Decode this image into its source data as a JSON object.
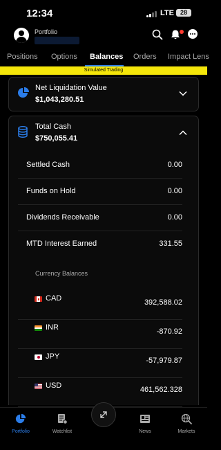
{
  "status_bar": {
    "time": "12:34",
    "network": "LTE",
    "battery": "28"
  },
  "header": {
    "title": "Portfolio"
  },
  "tabs": [
    {
      "label": "Positions"
    },
    {
      "label": "Options"
    },
    {
      "label": "Balances"
    },
    {
      "label": "Orders"
    },
    {
      "label": "Impact Lens"
    }
  ],
  "banner": {
    "text": "Simulated Trading"
  },
  "net_liquidation": {
    "title": "Net Liquidation Value",
    "value": "$1,043,280.51"
  },
  "total_cash": {
    "title": "Total Cash",
    "value": "$750,055.41",
    "rows": [
      {
        "label": "Settled Cash",
        "value": "0.00"
      },
      {
        "label": "Funds on Hold",
        "value": "0.00"
      },
      {
        "label": "Dividends Receivable",
        "value": "0.00"
      },
      {
        "label": "MTD Interest Earned",
        "value": "331.55"
      }
    ],
    "currency_section_title": "Currency Balances",
    "currencies": [
      {
        "code": "CAD",
        "amount": "392,588.02",
        "flag": "flag-canada-icon"
      },
      {
        "code": "INR",
        "amount": "-870.92",
        "flag": "flag-india-icon"
      },
      {
        "code": "JPY",
        "amount": "-57,979.87",
        "flag": "flag-japan-icon"
      },
      {
        "code": "USD",
        "amount": "461,562.328",
        "flag": "flag-usa-icon"
      }
    ]
  },
  "bottom_nav": [
    {
      "label": "Portfolio",
      "icon": "pie-chart-icon"
    },
    {
      "label": "Watchlist",
      "icon": "watchlist-icon"
    },
    {
      "label": "",
      "icon": "expand-arrows-icon"
    },
    {
      "label": "News",
      "icon": "newspaper-icon"
    },
    {
      "label": "Markets",
      "icon": "globe-search-icon"
    }
  ],
  "colors": {
    "accent": "#2b7de9",
    "banner": "#f5e60a",
    "background": "#000000",
    "alert": "#ff3b30"
  }
}
